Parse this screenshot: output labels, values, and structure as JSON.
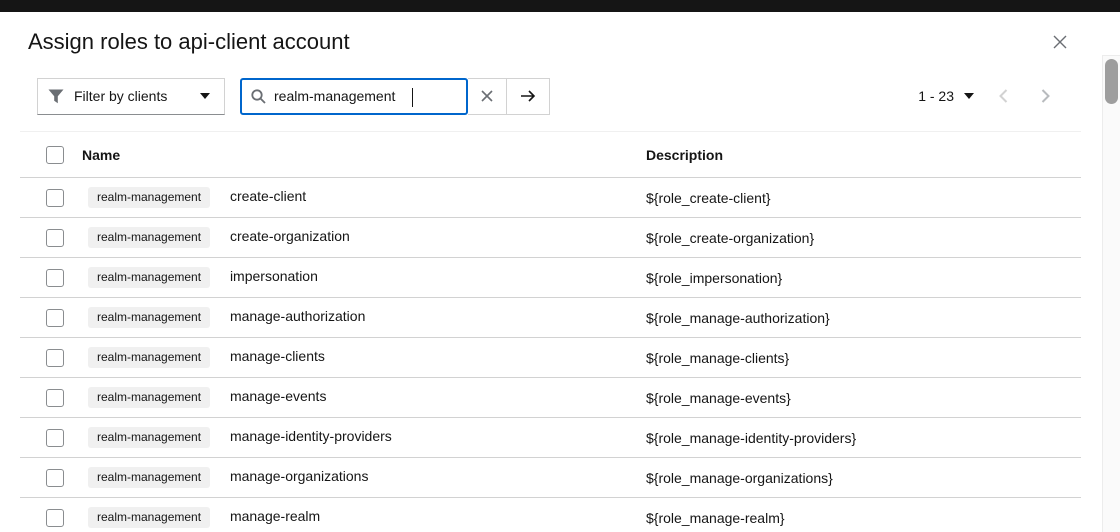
{
  "modal": {
    "title": "Assign roles to api-client account"
  },
  "toolbar": {
    "filter_label": "Filter by clients",
    "search_value": "realm-management",
    "pagination_range": "1 - 23"
  },
  "table": {
    "columns": {
      "name": "Name",
      "description": "Description"
    },
    "rows": [
      {
        "badge": "realm-management",
        "name": "create-client",
        "description": "${role_create-client}"
      },
      {
        "badge": "realm-management",
        "name": "create-organization",
        "description": "${role_create-organization}"
      },
      {
        "badge": "realm-management",
        "name": "impersonation",
        "description": "${role_impersonation}"
      },
      {
        "badge": "realm-management",
        "name": "manage-authorization",
        "description": "${role_manage-authorization}"
      },
      {
        "badge": "realm-management",
        "name": "manage-clients",
        "description": "${role_manage-clients}"
      },
      {
        "badge": "realm-management",
        "name": "manage-events",
        "description": "${role_manage-events}"
      },
      {
        "badge": "realm-management",
        "name": "manage-identity-providers",
        "description": "${role_manage-identity-providers}"
      },
      {
        "badge": "realm-management",
        "name": "manage-organizations",
        "description": "${role_manage-organizations}"
      },
      {
        "badge": "realm-management",
        "name": "manage-realm",
        "description": "${role_manage-realm}"
      }
    ]
  },
  "colors": {
    "accent": "#0066cc",
    "masthead": "#151515",
    "pill_background": "#f0f0f0",
    "border": "#d2d2d2"
  }
}
